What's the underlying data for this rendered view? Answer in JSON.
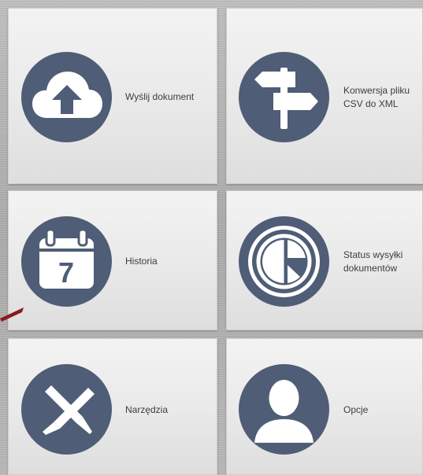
{
  "tiles": [
    {
      "label": "Wyślij dokument",
      "icon": "cloud-upload-icon"
    },
    {
      "label": "Konwersja pliku\nCSV do XML",
      "icon": "signpost-icon"
    },
    {
      "label": "Historia",
      "icon": "calendar-icon",
      "calendar_day": "7"
    },
    {
      "label": "Status wysyłki\ndokumentów",
      "icon": "pie-chart-target-icon"
    },
    {
      "label": "Narzędzia",
      "icon": "tools-icon"
    },
    {
      "label": "Opcje",
      "icon": "user-icon"
    }
  ],
  "colors": {
    "icon_circle": "#4f5d76",
    "icon_fg": "#ffffff",
    "label_text": "#3d3d3d",
    "tile_bg": "#ececec",
    "arrow": "#8b1a1a"
  }
}
